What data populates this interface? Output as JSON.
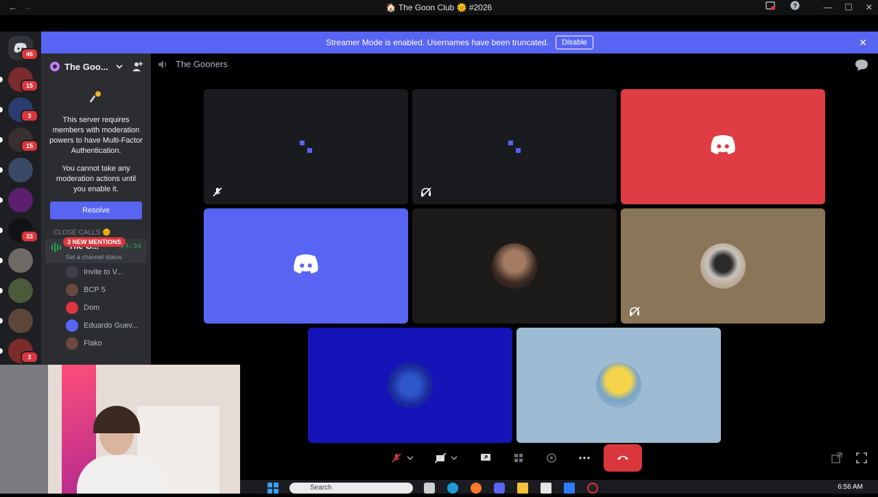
{
  "window": {
    "title": "🏠 The Goon Club 🌞 #2026",
    "nav_back": "←",
    "nav_forward": "→",
    "minimize": "—",
    "maximize": "☐",
    "close": "✕"
  },
  "banner": {
    "text": "Streamer Mode is enabled. Usernames have been truncated.",
    "disable_label": "Disable",
    "close": "✕"
  },
  "rail": {
    "dm_badge": "46",
    "servers": [
      {
        "badge": "15",
        "color": "#7a2b2b"
      },
      {
        "badge": "3",
        "color": "#2a3d6e"
      },
      {
        "badge": "15",
        "color": "#3a2f2f"
      },
      {
        "badge": "",
        "color": "#3a4a66"
      },
      {
        "badge": "",
        "color": "#5a1f6e"
      },
      {
        "badge": "33",
        "color": "#101214"
      },
      {
        "badge": "",
        "color": "#6e6a66"
      },
      {
        "badge": "",
        "color": "#4a5a3a"
      },
      {
        "badge": "",
        "color": "#5c4639"
      },
      {
        "badge": "3",
        "color": "#7c2a2a"
      },
      {
        "badge": "",
        "color": "#c9895a"
      }
    ]
  },
  "sidebar": {
    "guild_name": "The Goo...",
    "mfa_text": "This server requires members with moderation powers to have Multi-Factor Authentication.",
    "mfa_text2": "You cannot take any moderation actions until you enable it.",
    "resolve_label": "Resolve",
    "category": "CLOSE CALLS 🌞",
    "mentions_badge": "3 NEW MENTIONS",
    "voice_channel": {
      "name": "The G...",
      "time": "24:34",
      "status": "Set a channel status"
    },
    "voice_users": [
      {
        "name": "Invite to V...",
        "avatar": "invite"
      },
      {
        "name": "BCP 5",
        "avatar": "photo"
      },
      {
        "name": "Dom",
        "avatar": "red"
      },
      {
        "name": "Eduardo Guev...",
        "avatar": "blurple"
      },
      {
        "name": "Flako",
        "avatar": "photo"
      }
    ]
  },
  "channel_header": {
    "name": "The Gooners"
  },
  "colors": {
    "blurple": "#5865f2",
    "red_tile": "#e03c44",
    "gold_tile": "#8a7558",
    "blue_tile": "#1414b8",
    "sky_tile": "#9dbcd3",
    "dark_tile": "#1a1b1e",
    "end_call": "#da373c"
  },
  "taskbar": {
    "search_placeholder": "Search",
    "clock": "6:56 AM"
  }
}
